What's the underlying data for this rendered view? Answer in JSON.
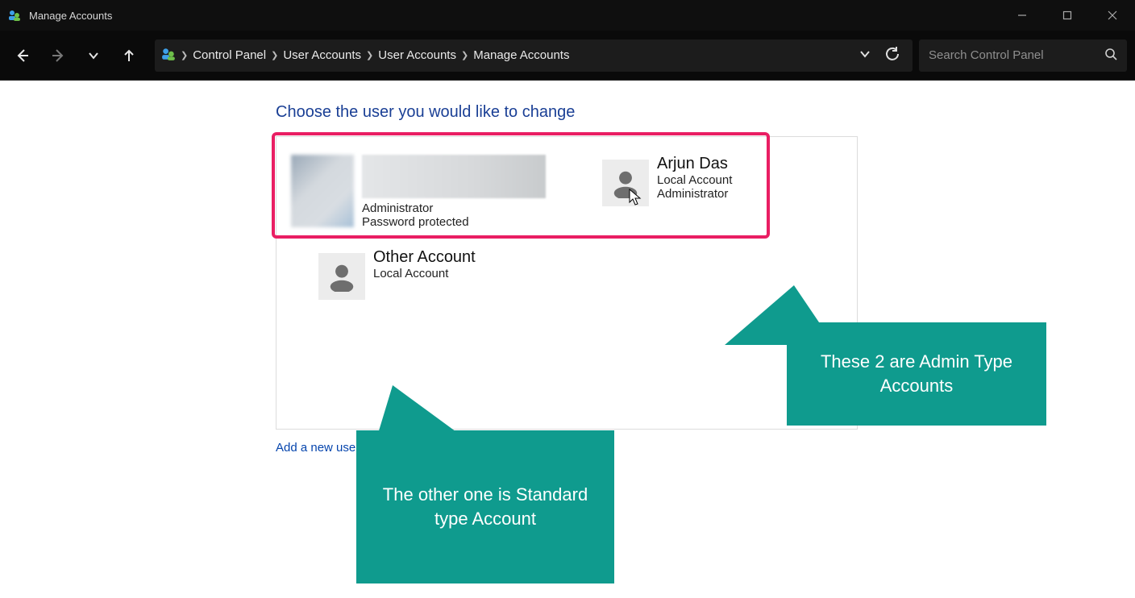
{
  "window": {
    "title": "Manage Accounts"
  },
  "breadcrumb": {
    "items": [
      "Control Panel",
      "User Accounts",
      "User Accounts",
      "Manage Accounts"
    ]
  },
  "search": {
    "placeholder": "Search Control Panel"
  },
  "page": {
    "heading": "Choose the user you would like to change",
    "add_link": "Add a new user in PC settings"
  },
  "accounts": [
    {
      "name": "",
      "type_line1": "Administrator",
      "type_line2": "Password protected",
      "avatar": "blurred"
    },
    {
      "name": "Arjun Das",
      "type_line1": "Local Account",
      "type_line2": "Administrator",
      "avatar": "generic"
    },
    {
      "name": "Other Account",
      "type_line1": "Local Account",
      "type_line2": "",
      "avatar": "generic"
    }
  ],
  "callouts": {
    "admin": "These 2 are Admin Type Accounts",
    "standard": "The other one is Standard type Account"
  }
}
